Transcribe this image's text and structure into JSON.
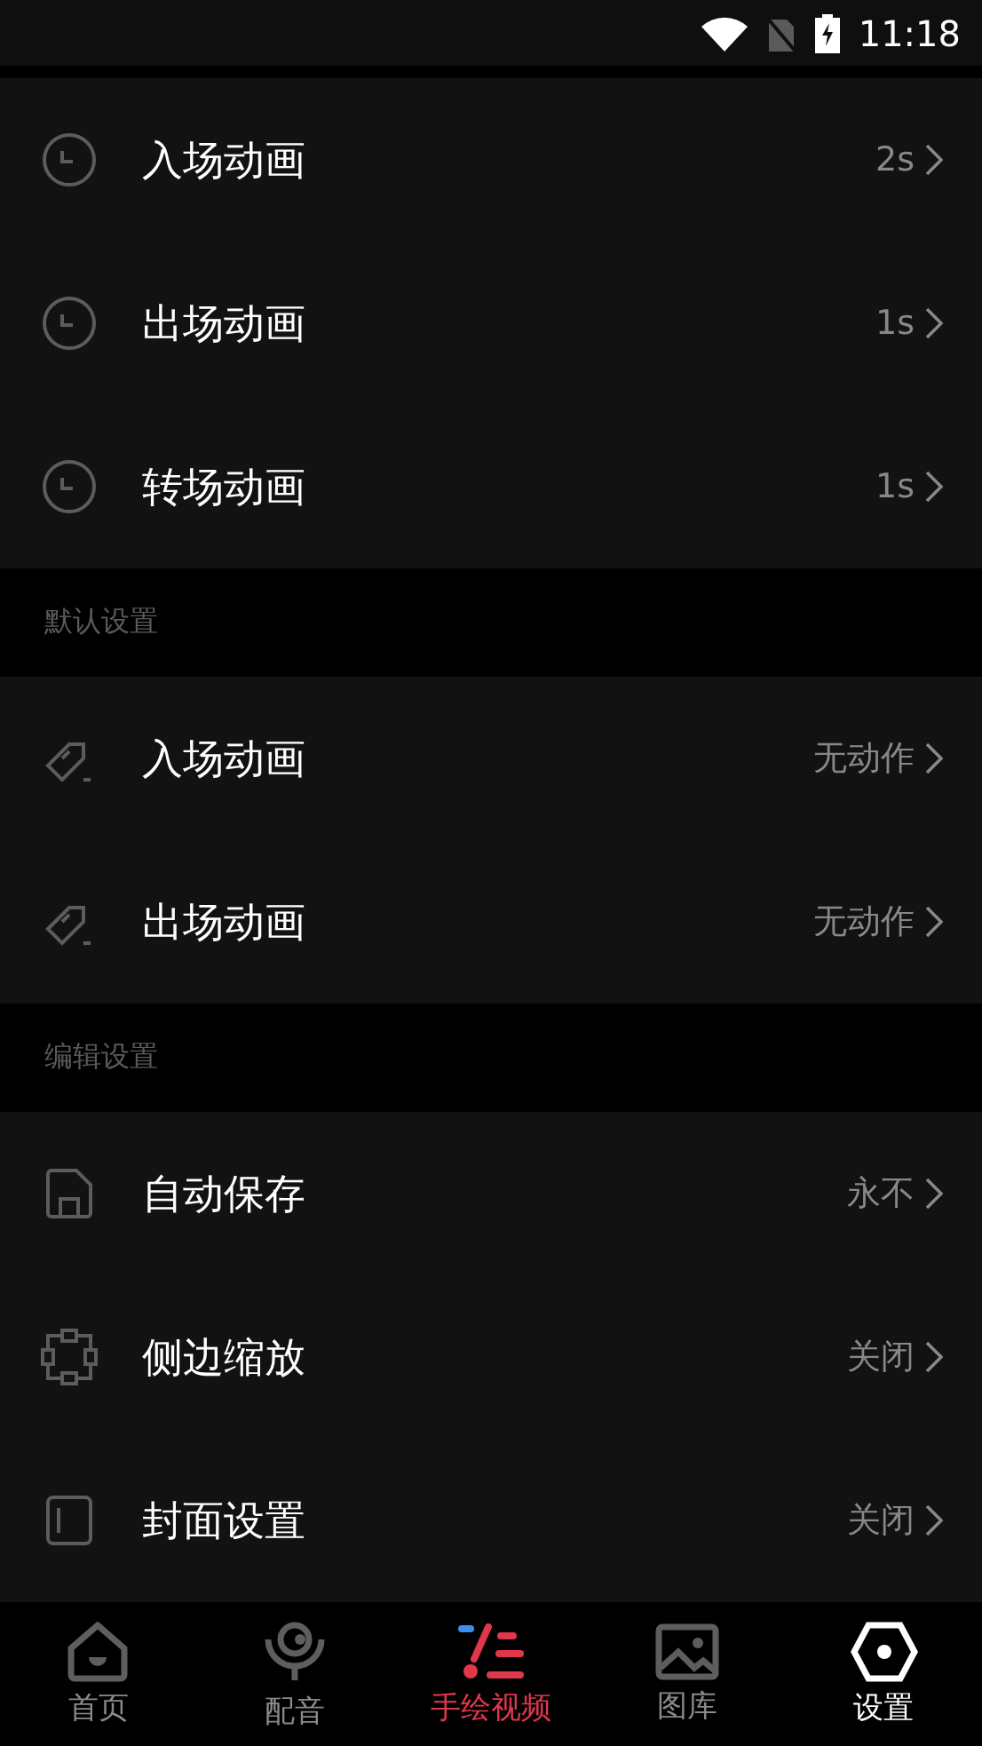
{
  "status_bar": {
    "time": "11:18"
  },
  "sections": [
    {
      "items": [
        {
          "kind": "clock",
          "label": "入场动画",
          "value": "2s"
        },
        {
          "kind": "clock",
          "label": "出场动画",
          "value": "1s"
        },
        {
          "kind": "clock",
          "label": "转场动画",
          "value": "1s"
        }
      ]
    },
    {
      "header": "默认设置",
      "items": [
        {
          "kind": "tag",
          "label": "入场动画",
          "value": "无动作"
        },
        {
          "kind": "tag",
          "label": "出场动画",
          "value": "无动作"
        }
      ]
    },
    {
      "header": "编辑设置",
      "items": [
        {
          "kind": "save",
          "label": "自动保存",
          "value": "永不"
        },
        {
          "kind": "nodes",
          "label": "侧边缩放",
          "value": "关闭"
        },
        {
          "kind": "panel",
          "label": "封面设置",
          "value": "关闭"
        }
      ]
    }
  ],
  "tab_bar": [
    {
      "kind": "home",
      "label": "首页",
      "selected": false
    },
    {
      "kind": "mic",
      "label": "配音",
      "selected": false
    },
    {
      "kind": "draw",
      "label": "手绘视频",
      "selected": false
    },
    {
      "kind": "gallery",
      "label": "图库",
      "selected": false
    },
    {
      "kind": "settings",
      "label": "设置",
      "selected": true
    }
  ]
}
